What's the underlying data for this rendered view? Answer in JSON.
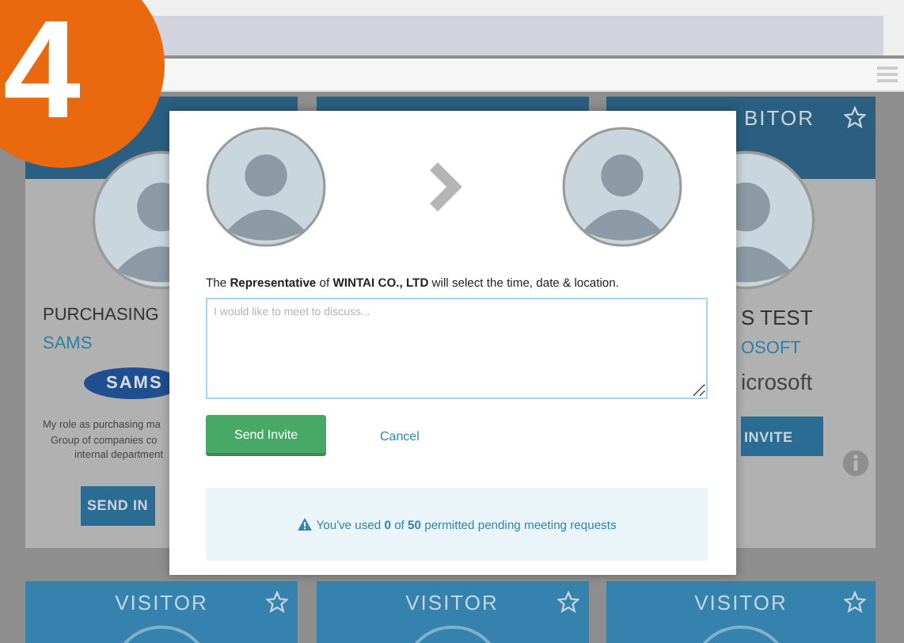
{
  "step_badge": "4",
  "cards": [
    {
      "kind": "left",
      "name": "PURCHASING",
      "company": "SAMS",
      "logo": "SAMS",
      "bio": [
        "My role as purchasing ma",
        "Group of companies co",
        "internal department"
      ],
      "button": "SEND IN"
    },
    {
      "kind": "blank"
    },
    {
      "kind": "right",
      "title": "BITOR",
      "name": "S TEST",
      "company": "OSOFT",
      "logo": "icrosoft",
      "button": "INVITE"
    }
  ],
  "bottom_cards": [
    {
      "title": "VISITOR"
    },
    {
      "title": "VISITOR"
    },
    {
      "title": "VISITOR"
    }
  ],
  "modal": {
    "sentence": "The **Representative** of **WINTAI CO., LTD** will select the time, date & location.",
    "message": {
      "placeholder": "I would like to meet to discuss..."
    },
    "send_button": "Send Invite",
    "cancel_link": "Cancel",
    "notice": "You've used **0** of **50** permitted pending meeting requests"
  }
}
